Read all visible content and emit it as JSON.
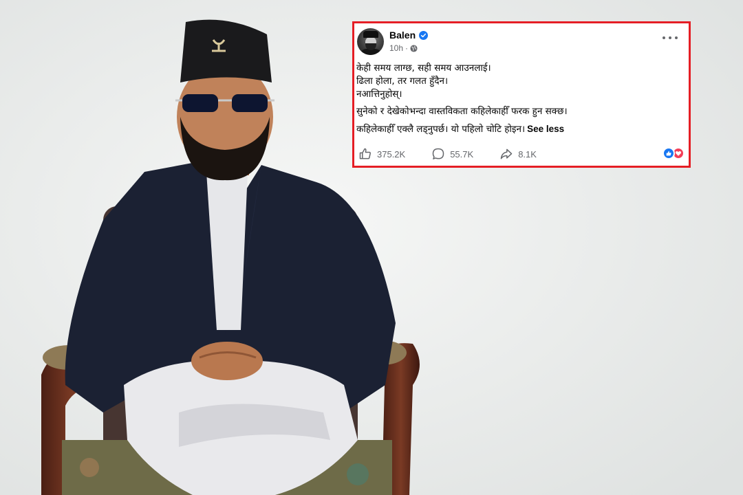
{
  "post": {
    "author": "Balen",
    "time": "10h",
    "time_separator": "·",
    "lines": [
      "केही समय लाग्छ, सही समय आउनलाई।",
      "ढिला होला, तर गलत हुँदैन।",
      "नआत्तिनुहोस्।",
      "सुनेको र देखेकोभन्दा वास्तविकता कहिलेकाहीँ फरक हुन सक्छ।",
      "कहिलेकाहीँ एक्लै लड्नुपर्छ। यो पहिलो चोटि होइन।"
    ],
    "see_less": "See less",
    "stats": {
      "likes": "375.2K",
      "comments": "55.7K",
      "shares": "8.1K"
    }
  },
  "icons": {
    "verified": "verified-badge-icon",
    "audience": "globe-icon",
    "more": "more-options-icon",
    "like": "thumbs-up-icon",
    "comment": "comment-bubble-icon",
    "share": "share-arrow-icon",
    "reaction_like": "like-reaction-icon",
    "reaction_love": "love-reaction-icon"
  },
  "colors": {
    "frame_border": "#e51e25",
    "verified_blue": "#1877f2",
    "love_red": "#f33e58",
    "muted_text": "#65676b"
  }
}
